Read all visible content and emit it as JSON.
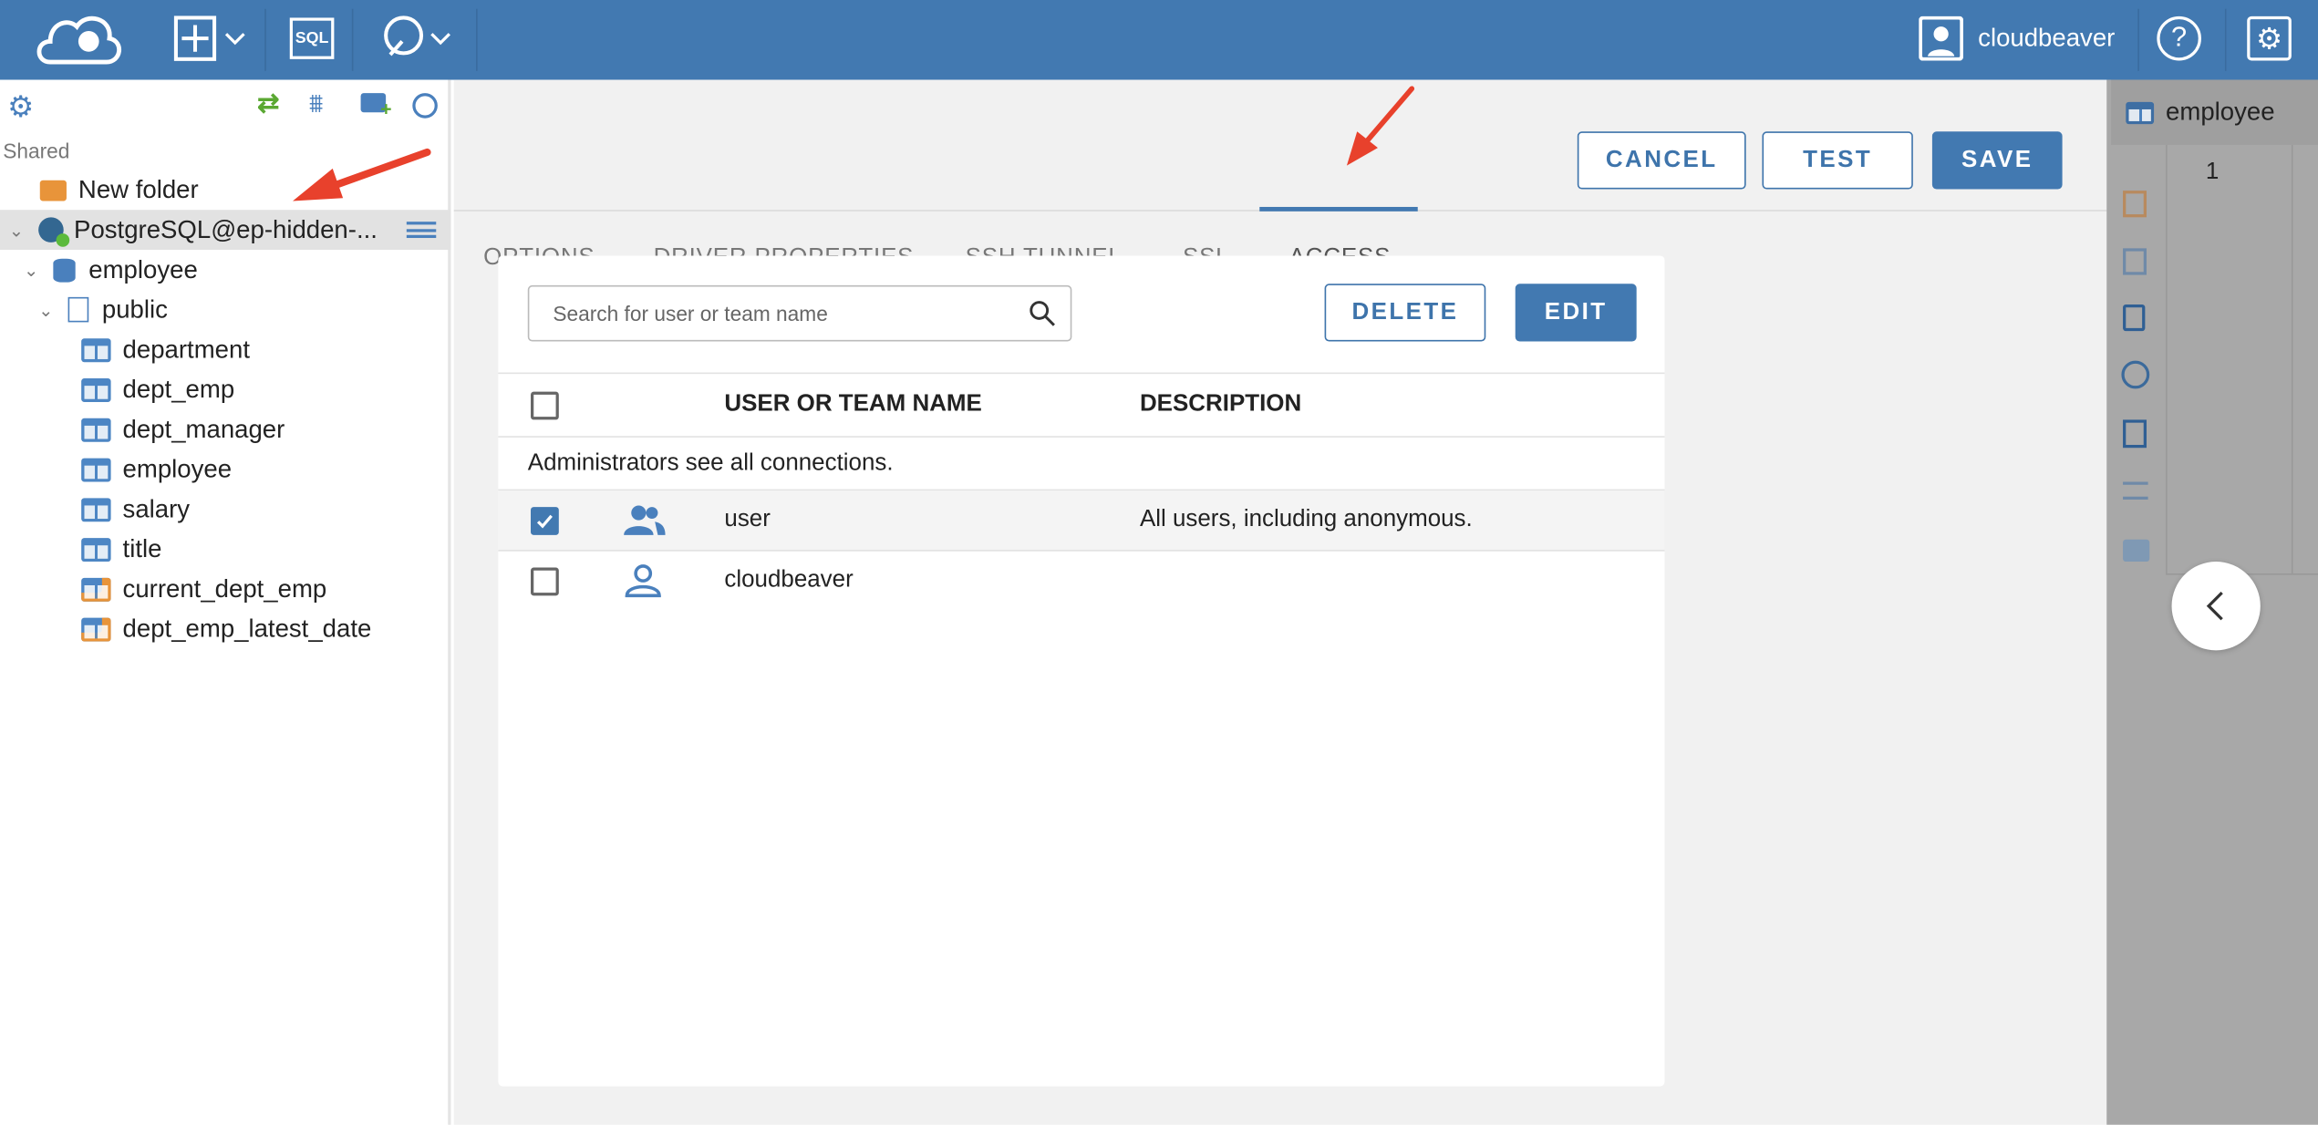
{
  "topbar": {
    "user": "cloudbeaver",
    "icons": [
      "cloudbeaver-logo",
      "new-connection-plus-icon",
      "sql-editor-icon",
      "tools-icon",
      "user-icon",
      "help-icon",
      "settings-icon"
    ]
  },
  "sidebar": {
    "section": "Shared",
    "items": [
      {
        "label": "New folder",
        "icon": "folder-icon"
      },
      {
        "label": "PostgreSQL@ep-hidden-...",
        "icon": "postgresql-icon"
      },
      {
        "label": "employee",
        "icon": "database-icon"
      },
      {
        "label": "public",
        "icon": "schema-icon"
      },
      {
        "label": "department",
        "icon": "table-icon"
      },
      {
        "label": "dept_emp",
        "icon": "table-icon"
      },
      {
        "label": "dept_manager",
        "icon": "table-icon"
      },
      {
        "label": "employee",
        "icon": "table-icon"
      },
      {
        "label": "salary",
        "icon": "table-icon"
      },
      {
        "label": "title",
        "icon": "table-icon"
      },
      {
        "label": "current_dept_emp",
        "icon": "view-icon"
      },
      {
        "label": "dept_emp_latest_date",
        "icon": "view-icon"
      }
    ]
  },
  "tabs": [
    "OPTIONS",
    "DRIVER PROPERTIES",
    "SSH TUNNEL",
    "SSL",
    "ACCESS"
  ],
  "active_tab": "ACCESS",
  "actions": {
    "cancel": "CANCEL",
    "test": "TEST",
    "save": "SAVE"
  },
  "access": {
    "search_placeholder": "Search for user or team name",
    "delete": "DELETE",
    "edit": "EDIT",
    "col_name": "USER OR TEAM NAME",
    "col_desc": "DESCRIPTION",
    "note": "Administrators see all connections.",
    "rows": [
      {
        "name": "user",
        "description": "All users, including anonymous.",
        "checked": true,
        "icon": "team-icon"
      },
      {
        "name": "cloudbeaver",
        "description": "",
        "checked": false,
        "icon": "user-icon"
      }
    ]
  },
  "right_panel": {
    "tab": "employee",
    "line": "1"
  },
  "colors": {
    "brand": "#4279b1",
    "annotation": "#e8412c"
  }
}
